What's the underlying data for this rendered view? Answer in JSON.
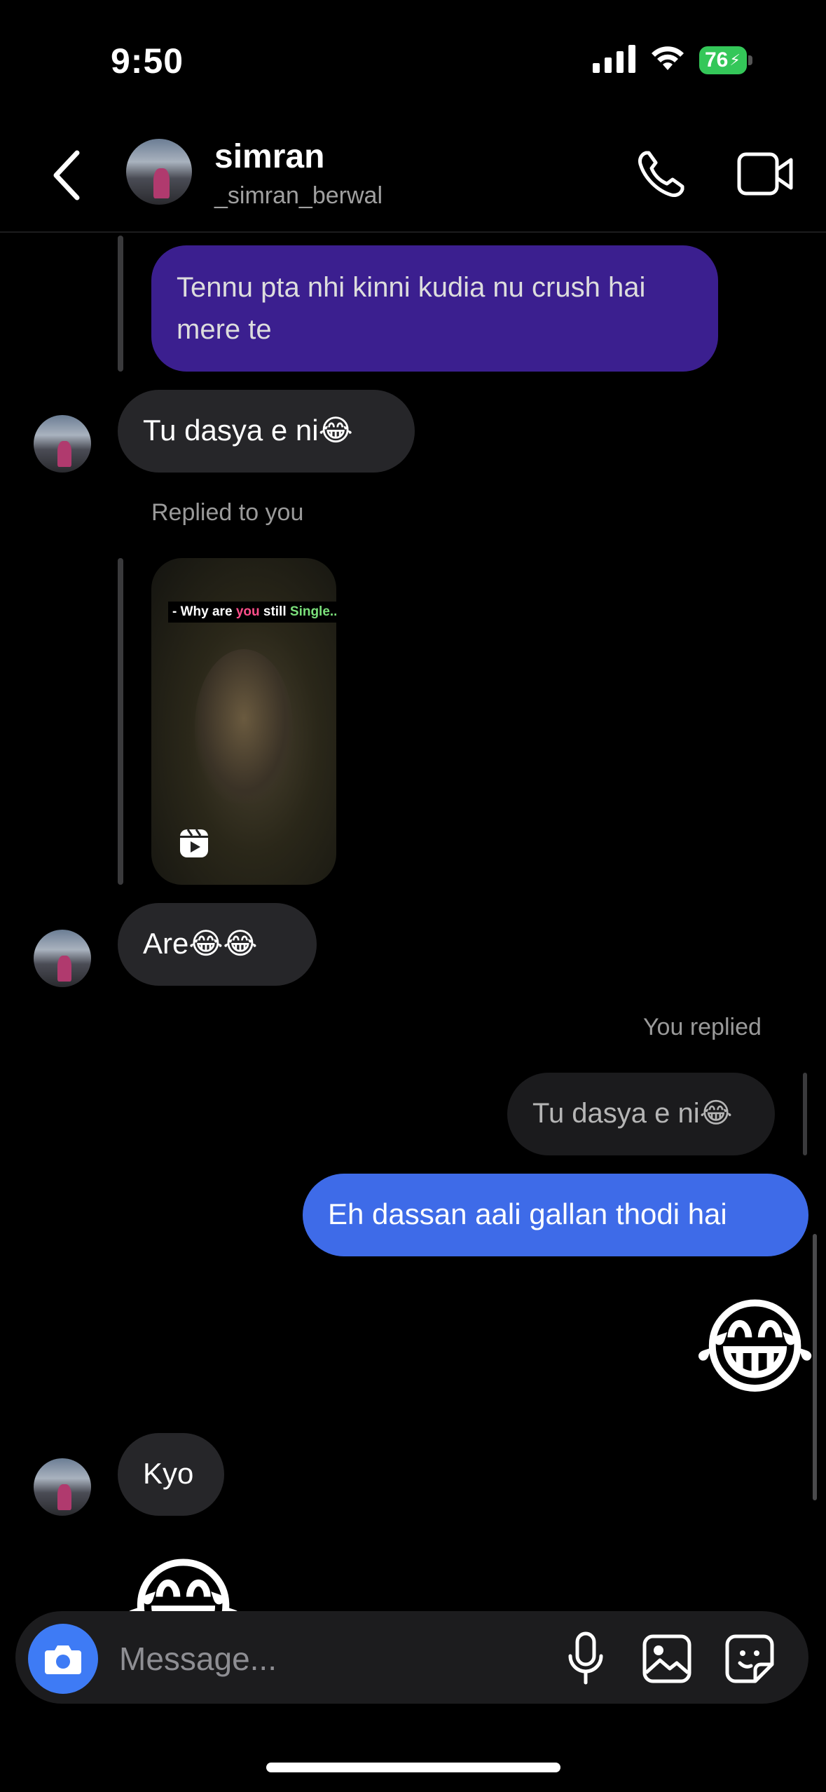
{
  "status_bar": {
    "time": "9:50",
    "battery": "76"
  },
  "header": {
    "name": "simran",
    "username": "_simran_berwal"
  },
  "messages": {
    "quoted_text": "Tennu pta nhi kinni kudia nu crush hai mere te",
    "msg1": "Tu dasya e ni😂",
    "replied_label": "Replied to you",
    "reel_caption_prefix": "- Why are ",
    "reel_caption_you": "you",
    "reel_caption_still": " still ",
    "reel_caption_single": "Single..",
    "msg2": "Are😂😂",
    "you_replied_label": "You replied",
    "quoted_reply": "Tu dasya e ni😂",
    "sent1": "Eh dassan aali gallan thodi hai",
    "sent_emoji": "😂",
    "msg3": "Kyo",
    "recv_emoji": "😂"
  },
  "composer": {
    "placeholder": "Message..."
  },
  "colors": {
    "purple_bubble": "#3b1f8f",
    "blue_bubble": "#3e6be8",
    "gray_bubble": "#262629",
    "camera": "#3e7bf5"
  }
}
